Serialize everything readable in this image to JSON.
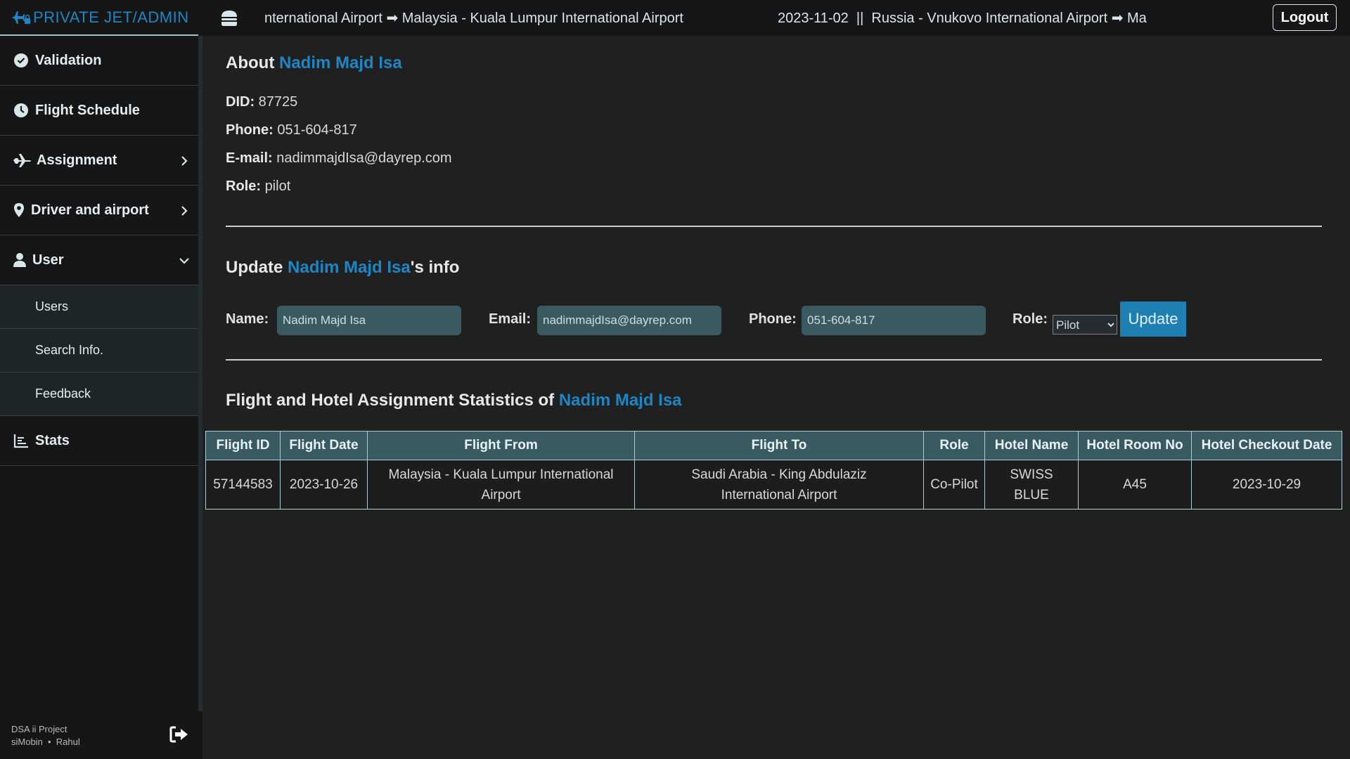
{
  "topbar": {
    "brand": "PRIVATE JET/ADMIN",
    "ticker_1": "nternational Airport ➡ Malaysia - Kuala Lumpur International Airport",
    "ticker_2": "2023-11-02  ||  Russia - Vnukovo International Airport ➡ Ma",
    "logout_label": "Logout"
  },
  "sidebar": {
    "items": [
      {
        "label": "Validation",
        "icon": "check-circle-icon"
      },
      {
        "label": "Flight Schedule",
        "icon": "clock-icon"
      },
      {
        "label": "Assignment",
        "icon": "plane-icon",
        "has_submenu": true
      },
      {
        "label": "Driver and airport",
        "icon": "map-pin-icon",
        "has_submenu": true
      },
      {
        "label": "User",
        "icon": "user-icon",
        "expanded": true,
        "children": [
          "Users",
          "Search Info.",
          "Feedback"
        ]
      },
      {
        "label": "Stats",
        "icon": "bar-chart-icon"
      }
    ],
    "footer": {
      "project": "DSA ii Project",
      "authors": "siMobin  •  Rahul"
    }
  },
  "about": {
    "title_prefix": "About ",
    "name": "Nadim Majd Isa",
    "did_label": "DID:",
    "did": "87725",
    "phone_label": "Phone:",
    "phone": "051-604-817",
    "email_label": "E-mail:",
    "email": "nadimmajdIsa@dayrep.com",
    "role_label": "Role:",
    "role": "pilot"
  },
  "update": {
    "title_prefix": "Update ",
    "name": "Nadim Majd Isa",
    "title_suffix": "'s info",
    "name_label": "Name:",
    "name_value": "Nadim Majd Isa",
    "email_label": "Email:",
    "email_value": "nadimmajdIsa@dayrep.com",
    "phone_label": "Phone:",
    "phone_value": "051-604-817",
    "role_label": "Role:",
    "role_selected": "Pilot",
    "button_label": "Update"
  },
  "stats": {
    "title_prefix": "Flight and Hotel Assignment Statistics of ",
    "name": "Nadim Majd Isa",
    "columns": [
      "Flight ID",
      "Flight Date",
      "Flight From",
      "Flight To",
      "Role",
      "Hotel Name",
      "Hotel Room No",
      "Hotel Checkout Date"
    ],
    "rows": [
      [
        "57144583",
        "2023-10-26",
        "Malaysia - Kuala Lumpur International Airport",
        "Saudi Arabia - King Abdulaziz International Airport",
        "Co-Pilot",
        "SWISS BLUE",
        "A45",
        "2023-10-29"
      ]
    ]
  }
}
